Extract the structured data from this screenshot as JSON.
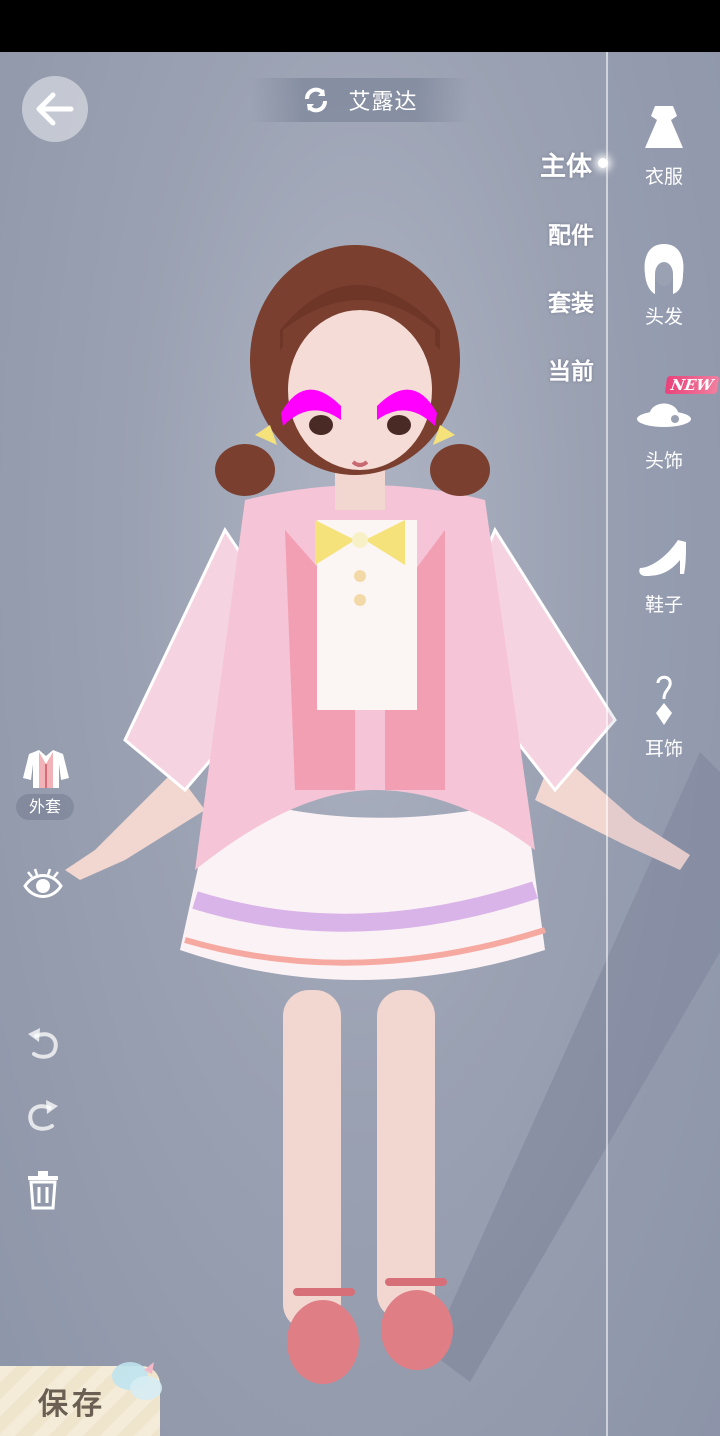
{
  "header": {
    "title": "艾露达",
    "switch_icon": "swap-icon",
    "back_icon": "arrow-left-icon"
  },
  "categories": [
    {
      "label": "主体",
      "active": true
    },
    {
      "label": "配件",
      "active": false
    },
    {
      "label": "套装",
      "active": false
    },
    {
      "label": "当前",
      "active": false
    }
  ],
  "slots": [
    {
      "label": "衣服",
      "icon": "dress-icon"
    },
    {
      "label": "头发",
      "icon": "hair-icon"
    },
    {
      "label": "头饰",
      "icon": "hat-icon",
      "badge": "NEW"
    },
    {
      "label": "鞋子",
      "icon": "high-heel-icon"
    },
    {
      "label": "耳饰",
      "icon": "earring-icon"
    }
  ],
  "left_tools": {
    "coat_label": "外套",
    "coat_icon": "coat-icon",
    "eye_icon": "eye-icon",
    "undo_icon": "undo-icon",
    "redo_icon": "redo-icon",
    "trash_icon": "trash-icon"
  },
  "save": {
    "label": "保存"
  },
  "colors": {
    "accent_new": "#e9427a",
    "background": "#9fa6b6",
    "dress_pink": "#f4b8cf",
    "bow_yellow": "#f6e27a"
  }
}
